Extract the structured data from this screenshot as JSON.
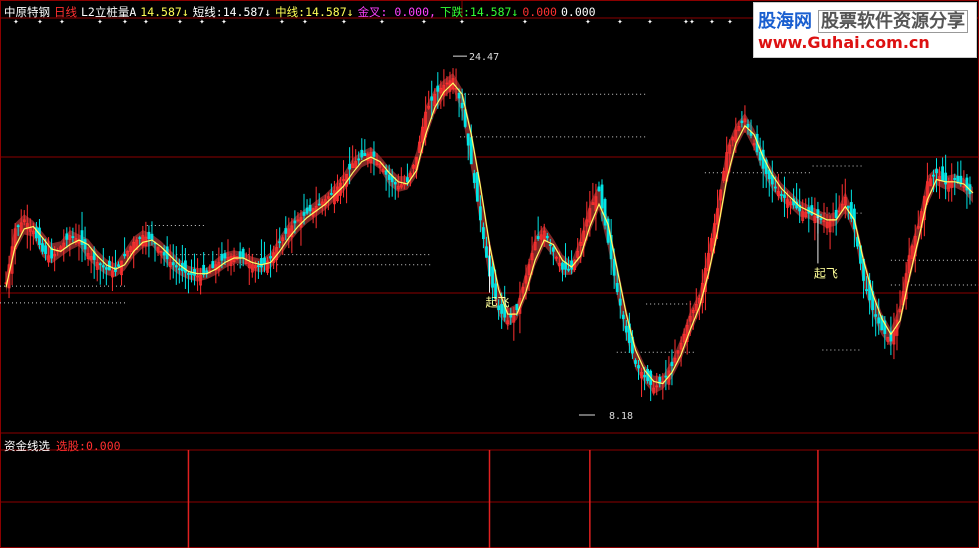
{
  "header": {
    "stock": "中原特钢",
    "period": "日线",
    "indicator": "L2立桩量A",
    "value_main": "14.587↓",
    "short_label": "短线:",
    "short_value": "14.587↓",
    "mid_label": "中线:",
    "mid_value": "14.587↓",
    "golden_cross": "金叉: 0.000,",
    "down_label": "下跌:",
    "down_value": "14.587↓",
    "extra1": "0.000",
    "extra2": "0.000"
  },
  "sub_header": {
    "title": "资金线选",
    "signal_label": "选股:",
    "signal_value": "0.000"
  },
  "logo": {
    "brand": "股海网",
    "tagline": "股票软件资源分享",
    "url": "www.Guhai.com.cn"
  },
  "colors": {
    "background": "#000000",
    "candle_up": "#ff3030",
    "candle_down": "#00e5e5",
    "band_fill": "#8b2a2a",
    "midline": "#ffff66",
    "signal": "#e02020",
    "grid": "#8b0000",
    "text_white": "#ffffff",
    "text_yellow": "#ffff55",
    "text_red": "#ff3030",
    "text_magenta": "#ff40ff",
    "text_green": "#33ff33"
  },
  "chart_data": {
    "type": "candlestick",
    "ylim": [
      7.5,
      26
    ],
    "price_high_label": "24.47",
    "price_low_label": "8.18",
    "close_series": [
      14.2,
      16.6,
      17.0,
      16.5,
      15.6,
      15.3,
      15.8,
      16.3,
      16.1,
      15.5,
      15.1,
      14.8,
      14.7,
      15.4,
      16.0,
      16.3,
      16.1,
      15.6,
      15.1,
      14.8,
      14.6,
      14.5,
      14.6,
      15.0,
      15.3,
      15.4,
      15.3,
      15.0,
      14.9,
      15.3,
      16.0,
      16.6,
      17.0,
      17.3,
      17.6,
      17.9,
      18.3,
      18.8,
      19.5,
      19.8,
      20.0,
      19.5,
      18.8,
      18.5,
      18.7,
      19.8,
      21.8,
      22.6,
      23.0,
      23.3,
      22.0,
      19.5,
      17.0,
      14.5,
      13.0,
      12.5,
      13.0,
      14.5,
      16.0,
      16.5,
      15.6,
      14.8,
      14.8,
      16.0,
      17.5,
      18.3,
      16.0,
      13.8,
      12.0,
      10.6,
      10.0,
      9.5,
      9.8,
      10.5,
      11.5,
      12.7,
      13.5,
      15.5,
      17.5,
      20.0,
      21.0,
      21.5,
      20.4,
      19.3,
      18.6,
      18.1,
      17.8,
      17.4,
      17.3,
      17.1,
      16.9,
      17.1,
      18.0,
      16.6,
      14.3,
      13.0,
      12.1,
      11.6,
      13.0,
      15.4,
      16.7,
      18.7,
      19.1,
      18.6,
      18.8,
      18.5,
      18.0
    ],
    "ma_series": [
      14.0,
      15.8,
      16.6,
      16.7,
      16.2,
      15.7,
      15.6,
      15.9,
      16.1,
      15.9,
      15.4,
      15.0,
      14.8,
      15.0,
      15.6,
      16.0,
      16.1,
      15.8,
      15.4,
      15.0,
      14.7,
      14.6,
      14.6,
      14.8,
      15.1,
      15.3,
      15.3,
      15.1,
      15.0,
      15.1,
      15.6,
      16.2,
      16.7,
      17.1,
      17.4,
      17.7,
      18.1,
      18.5,
      19.1,
      19.6,
      19.8,
      19.6,
      19.1,
      18.7,
      18.6,
      19.2,
      20.8,
      22.0,
      22.7,
      23.1,
      22.6,
      20.8,
      18.5,
      15.9,
      13.9,
      12.8,
      12.8,
      13.8,
      15.2,
      16.1,
      15.9,
      15.2,
      14.9,
      15.4,
      16.7,
      17.7,
      16.8,
      14.8,
      12.8,
      11.2,
      10.3,
      9.8,
      9.7,
      10.2,
      11.0,
      12.1,
      13.1,
      14.6,
      16.5,
      18.8,
      20.4,
      21.2,
      20.8,
      19.8,
      19.0,
      18.4,
      18.0,
      17.6,
      17.4,
      17.2,
      17.0,
      17.0,
      17.6,
      17.0,
      15.2,
      13.7,
      12.6,
      11.9,
      12.5,
      14.4,
      16.1,
      17.9,
      18.8,
      18.7,
      18.7,
      18.6,
      18.2
    ],
    "resistance_levels": [
      {
        "y": 13.3,
        "x0": 0.0,
        "x1": 0.13
      },
      {
        "y": 14.05,
        "x0": 0.0,
        "x1": 0.13
      },
      {
        "y": 16.75,
        "x0": 0.15,
        "x1": 0.21
      },
      {
        "y": 15.45,
        "x0": 0.18,
        "x1": 0.44
      },
      {
        "y": 15.0,
        "x0": 0.23,
        "x1": 0.44
      },
      {
        "y": 22.6,
        "x0": 0.47,
        "x1": 0.66
      },
      {
        "y": 20.7,
        "x0": 0.47,
        "x1": 0.66
      },
      {
        "y": 19.1,
        "x0": 0.72,
        "x1": 0.83
      },
      {
        "y": 19.4,
        "x0": 0.83,
        "x1": 0.88
      },
      {
        "y": 17.3,
        "x0": 0.83,
        "x1": 0.88
      },
      {
        "y": 13.25,
        "x0": 0.66,
        "x1": 0.71
      },
      {
        "y": 11.1,
        "x0": 0.63,
        "x1": 0.71
      },
      {
        "y": 15.2,
        "x0": 0.91,
        "x1": 1.0
      },
      {
        "y": 14.1,
        "x0": 0.91,
        "x1": 1.0
      },
      {
        "y": 11.2,
        "x0": 0.84,
        "x1": 0.88
      }
    ],
    "annotations": [
      {
        "text": "起飞",
        "index": 53
      },
      {
        "text": "起飞",
        "index": 89
      },
      {
        "text": "24.47",
        "index": 49,
        "kind": "high"
      },
      {
        "text": "8.18",
        "index": 65,
        "kind": "low"
      }
    ],
    "signal_indices": [
      20,
      53,
      64,
      89
    ]
  }
}
